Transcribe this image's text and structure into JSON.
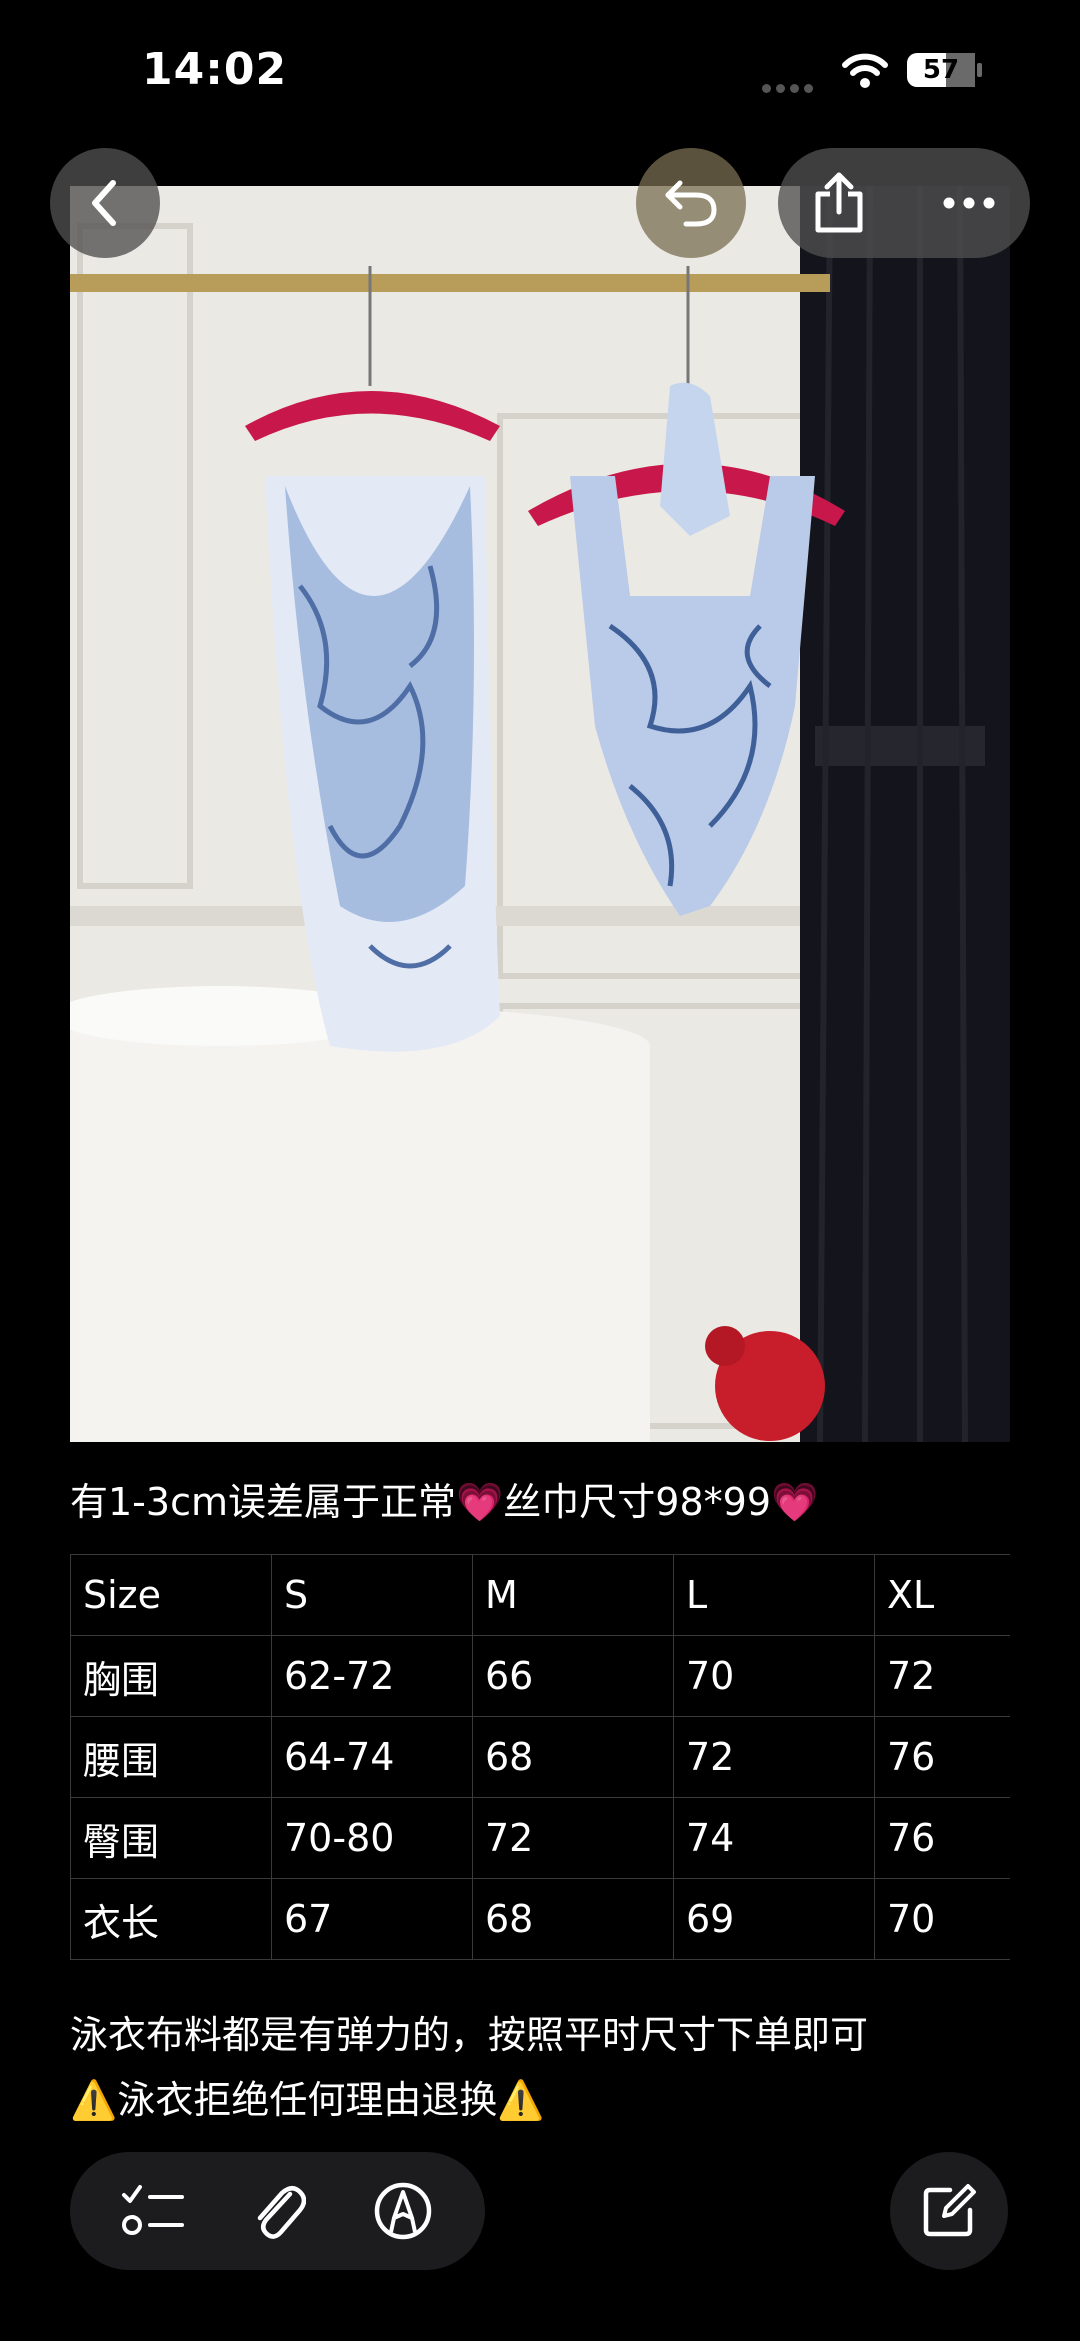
{
  "status": {
    "time": "14:02",
    "battery": "57"
  },
  "nav": {
    "back_icon": "chevron-left-icon",
    "undo_icon": "undo-icon",
    "share_icon": "share-icon",
    "more_icon": "more-icon"
  },
  "note": {
    "line1": "有1-3cm误差属于正常💗丝巾尺寸98*99💗",
    "table": {
      "headers": [
        "Size",
        "S",
        "M",
        "L",
        "XL"
      ],
      "rows": [
        [
          "胸围",
          "62-72",
          "66",
          "70",
          "72"
        ],
        [
          "腰围",
          "64-74",
          "68",
          "72",
          "76"
        ],
        [
          "臀围",
          "70-80",
          "72",
          "74",
          "76"
        ],
        [
          "衣长",
          "67",
          "68",
          "69",
          "70"
        ]
      ]
    },
    "line2": "泳衣布料都是有弹力的，按照平时尺寸下单即可",
    "line3": "⚠️泳衣拒绝任何理由退换⚠️"
  },
  "toolbar": {
    "checklist_icon": "checklist-icon",
    "attachment_icon": "paperclip-icon",
    "markup_icon": "markup-pen-icon",
    "compose_icon": "compose-icon"
  },
  "colors": {
    "background": "#000000",
    "toolbar_bg": "#1c1c1e",
    "table_border": "#3a3a3a",
    "hanger": "#c8174a"
  }
}
